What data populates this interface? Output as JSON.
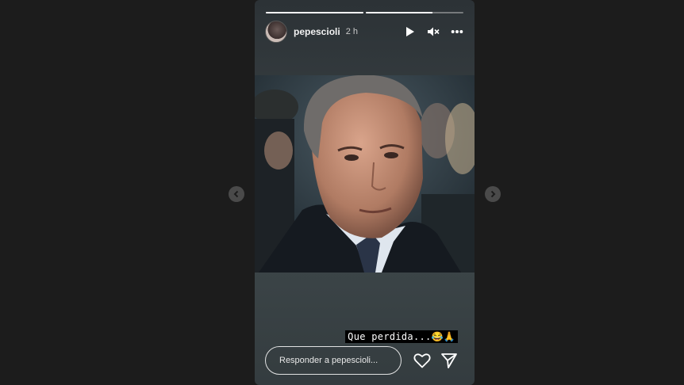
{
  "story": {
    "progress": [
      1.0,
      0.68
    ],
    "username": "pepescioli",
    "time": "2 h",
    "icons": [
      "play-icon",
      "mute-icon",
      "more-icon"
    ],
    "caption": "Que perdida...😂🙏",
    "reply_placeholder": "Responder a pepescioli...",
    "actions": [
      "heart-icon",
      "send-icon"
    ]
  },
  "navigation": {
    "prev_icon": "chevron-left-icon",
    "next_icon": "chevron-right-icon"
  }
}
